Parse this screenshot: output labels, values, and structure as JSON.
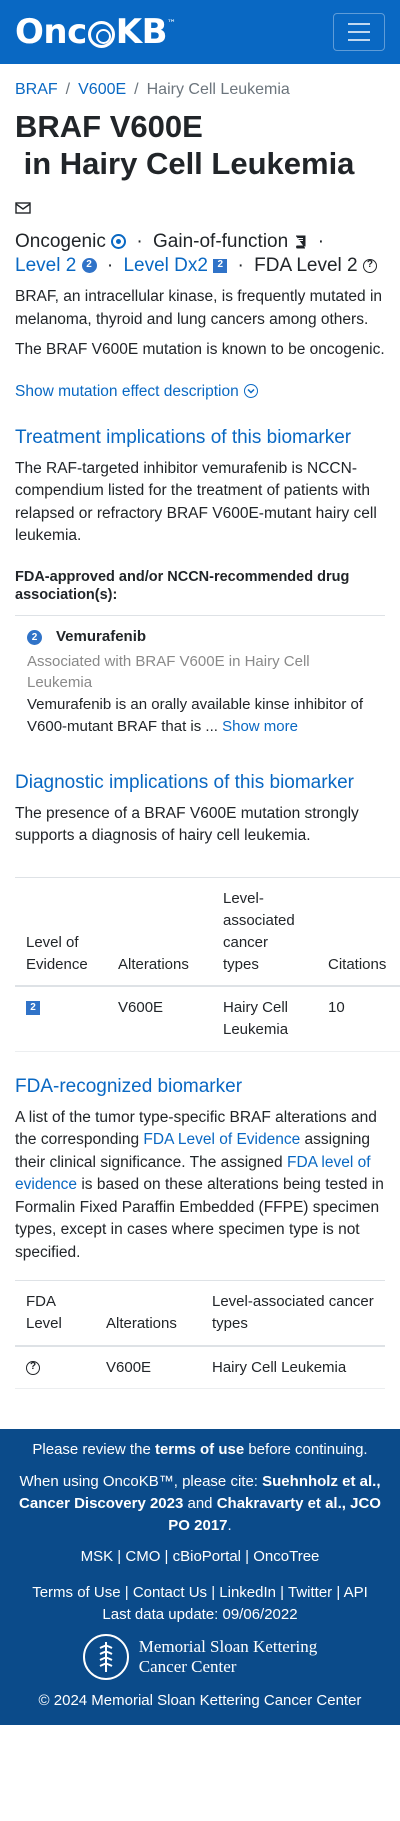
{
  "navbar": {
    "logo_text": "OncoKB",
    "logo_tm": "™",
    "menu_icon": "hamburger-icon"
  },
  "breadcrumb": {
    "gene": "BRAF",
    "alteration": "V600E",
    "tumor_type": "Hairy Cell Leukemia",
    "separator": "/"
  },
  "title": {
    "line1": "BRAF V600E",
    "line2": "in Hairy Cell Leukemia"
  },
  "tags": {
    "oncogenic": "Oncogenic",
    "effect": "Gain-of-function",
    "level": "Level 2",
    "level_badge": "2",
    "dx_level": "Level Dx2",
    "dx_badge": "2",
    "fda_level": "FDA Level 2",
    "separator": "·"
  },
  "gene_summary": "BRAF, an intracellular kinase, is frequently mutated in melanoma, thyroid and lung cancers among others.",
  "variant_summary": "The BRAF V600E mutation is known to be oncogenic.",
  "show_mutation_effect": "Show mutation effect description",
  "treatment": {
    "heading": "Treatment implications of this biomarker",
    "summary": "The RAF-targeted inhibitor vemurafenib is NCCN-compendium listed for the treatment of patients with relapsed or refractory BRAF V600E-mutant hairy cell leukemia.",
    "subheading": "FDA-approved and/or NCCN-recommended drug association(s):",
    "drug": {
      "badge": "2",
      "name": "Vemurafenib",
      "association": "Associated with BRAF V600E in Hairy Cell Leukemia",
      "description": "Vemurafenib is an orally available kinse inhibitor of V600-mutant BRAF that is",
      "ellipsis": "...",
      "show_more": "Show more"
    }
  },
  "diagnostic": {
    "heading": "Diagnostic implications of this biomarker",
    "summary": "The presence of a BRAF V600E mutation strongly supports a diagnosis of hairy cell leukemia.",
    "table": {
      "headers": [
        "Level of Evidence",
        "Alterations",
        "Level-associated cancer types",
        "Citations"
      ],
      "row": {
        "level_badge": "2",
        "alteration": "V600E",
        "cancer_type": "Hairy Cell Leukemia",
        "citations": "10"
      }
    }
  },
  "fda": {
    "heading": "FDA-recognized biomarker",
    "text_1": "A list of the tumor type-specific BRAF alterations and the corresponding",
    "link_1": "FDA Level of Evidence",
    "text_2": "assigning their clinical significance. The assigned",
    "link_2": "FDA level of evidence",
    "text_3": "is based on these alterations being tested in Formalin Fixed Paraffin Embedded (FFPE) specimen types, except in cases where specimen type is not specified.",
    "table": {
      "headers": [
        "FDA Level",
        "Alterations",
        "Level-associated cancer types"
      ],
      "row": {
        "level_icon": "question-circle-icon",
        "alteration": "V600E",
        "cancer_type": "Hairy Cell Leukemia"
      }
    }
  },
  "footer": {
    "review_pre": "Please review the",
    "terms_bold": "terms of use",
    "review_post": "before continuing.",
    "cite_pre": "When using OncoKB™, please cite:",
    "cite_1": "Suehnholz et al., Cancer Discovery 2023",
    "cite_and": "and",
    "cite_2": "Chakravarty et al., JCO PO 2017",
    "cite_end": ".",
    "links_row1": [
      "MSK",
      "CMO",
      "cBioPortal",
      "OncoTree"
    ],
    "link_sep": "|",
    "terms_link": "Terms of Use",
    "contact_us": "Contact Us",
    "linkedin": "LinkedIn",
    "twitter": "Twitter",
    "api": "API",
    "last_update": "Last data update: 09/06/2022",
    "msk_line1": "Memorial Sloan Kettering",
    "msk_line2": "Cancer Center",
    "copyright": "© 2024 Memorial Sloan Kettering Cancer Center"
  },
  "colors": {
    "brand_blue": "#0968c3",
    "footer_blue": "#0b4b8a",
    "level2_blue": "#3073c8"
  }
}
